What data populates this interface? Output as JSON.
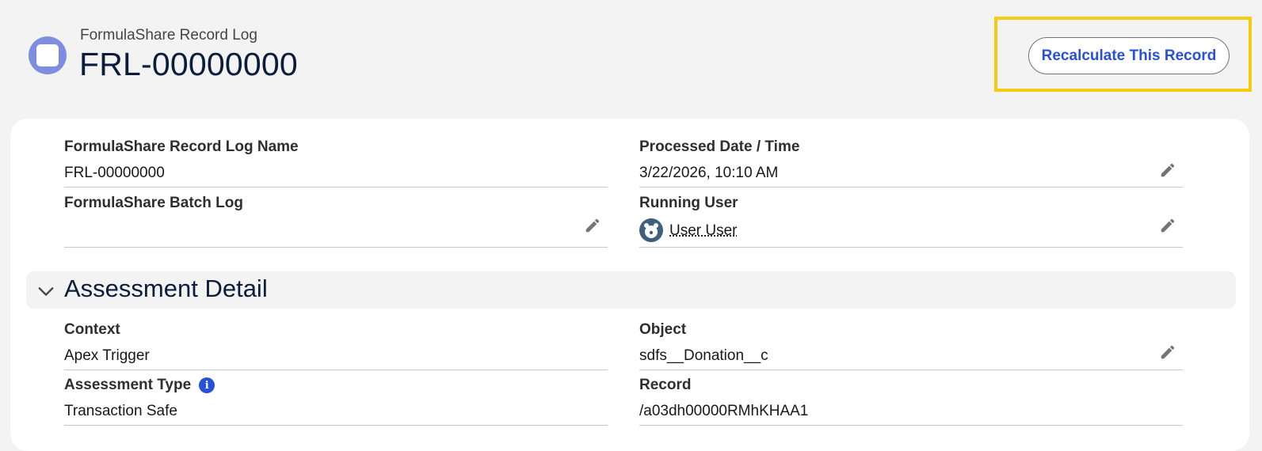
{
  "header": {
    "object_type": "FormulaShare Record Log",
    "record_name": "FRL-00000000",
    "recalculate_button": "Recalculate This Record"
  },
  "fields": {
    "record_log_name": {
      "label": "FormulaShare Record Log Name",
      "value": "FRL-00000000"
    },
    "processed_datetime": {
      "label": "Processed Date / Time",
      "value": "3/22/2026, 10:10 AM"
    },
    "batch_log": {
      "label": "FormulaShare Batch Log",
      "value": ""
    },
    "running_user": {
      "label": "Running User",
      "value": "User User"
    }
  },
  "assessment_section": {
    "title": "Assessment Detail",
    "context": {
      "label": "Context",
      "value": "Apex Trigger"
    },
    "object": {
      "label": "Object",
      "value": "sdfs__Donation__c"
    },
    "assessment_type": {
      "label": "Assessment Type",
      "value": "Transaction Safe"
    },
    "record": {
      "label": "Record",
      "value": "/a03dh00000RMhKHAA1"
    }
  },
  "colors": {
    "brand_blue": "#2751d6",
    "object_icon": "#7f8de1",
    "highlight": "#f6cc12",
    "title_navy": "#0b1d3a"
  },
  "icons": {
    "object_icon": "record-log-icon",
    "edit_icon": "pencil-icon",
    "info_icon": "info-icon",
    "collapse_icon": "chevron-down-icon",
    "user_icon": "user-avatar-icon"
  }
}
